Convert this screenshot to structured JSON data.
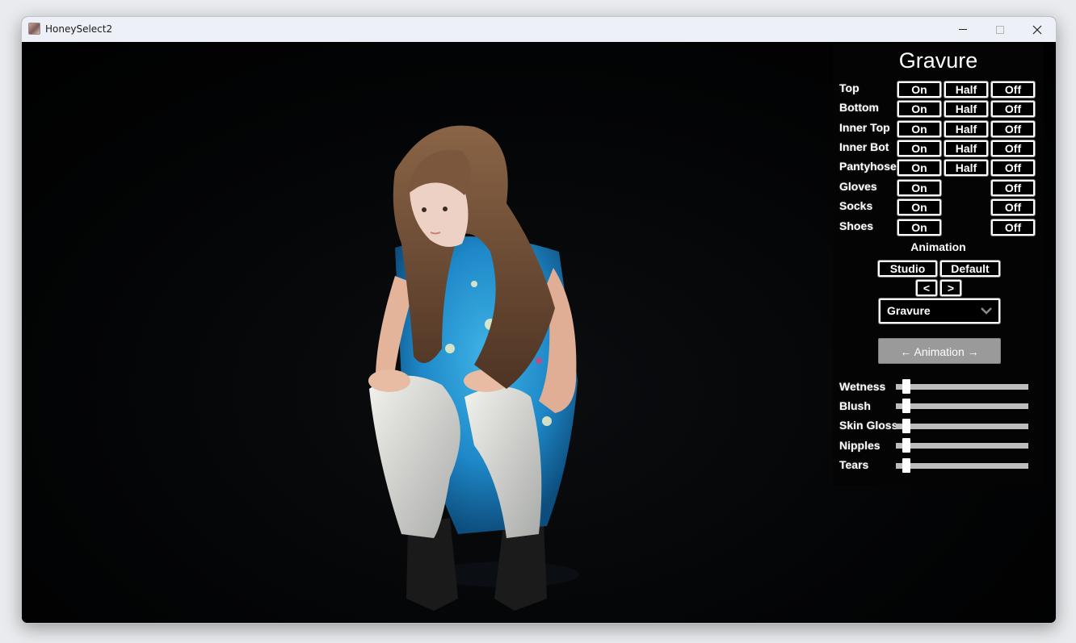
{
  "window": {
    "title": "HoneySelect2"
  },
  "panel": {
    "title": "Gravure",
    "clothing_rows": [
      {
        "label": "Top",
        "on": "On",
        "half": "Half",
        "off": "Off"
      },
      {
        "label": "Bottom",
        "on": "On",
        "half": "Half",
        "off": "Off"
      },
      {
        "label": "Inner Top",
        "on": "On",
        "half": "Half",
        "off": "Off"
      },
      {
        "label": "Inner Bot",
        "on": "On",
        "half": "Half",
        "off": "Off"
      },
      {
        "label": "Pantyhose",
        "on": "On",
        "half": "Half",
        "off": "Off"
      },
      {
        "label": "Gloves",
        "on": "On",
        "off": "Off"
      },
      {
        "label": "Socks",
        "on": "On",
        "off": "Off"
      },
      {
        "label": "Shoes",
        "on": "On",
        "off": "Off"
      }
    ],
    "animation": {
      "label": "Animation",
      "studio": "Studio",
      "default": "Default",
      "prev": "<",
      "next": ">",
      "selected": "Gravure",
      "toggle": "← Animation →"
    },
    "sliders": [
      {
        "label": "Wetness",
        "value": 0
      },
      {
        "label": "Blush",
        "value": 0
      },
      {
        "label": "Skin Gloss",
        "value": 0
      },
      {
        "label": "Nipples",
        "value": 0
      },
      {
        "label": "Tears",
        "value": 0
      }
    ]
  },
  "colors": {
    "panel_bg": "#040404",
    "button_border": "#ffffff",
    "grey_button": "#9a9a9a"
  }
}
